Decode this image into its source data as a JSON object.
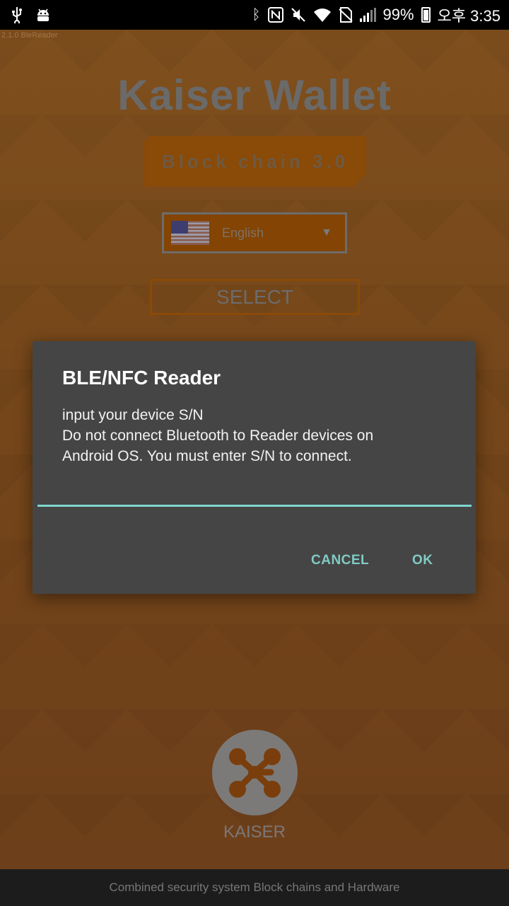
{
  "status_bar": {
    "left_icons": [
      "usb-icon",
      "android-debug-icon"
    ],
    "right_icons": [
      "bluetooth-icon",
      "nfc-icon",
      "mute-icon",
      "wifi-icon",
      "no-sim-icon",
      "signal-icon"
    ],
    "battery_percent": "99%",
    "time": "오후 3:35",
    "battery_level": 0.99
  },
  "app": {
    "version": "2.1.0 BleReader",
    "title": "Kaiser Wallet",
    "badge": "Block chain 3.0",
    "language": {
      "selected": "English",
      "flag_icon": "us-flag-icon"
    },
    "select_label": "SELECT",
    "logo_text": "KAISER",
    "footer": "Combined security system Block chains and Hardware"
  },
  "dialog": {
    "title": "BLE/NFC Reader",
    "message_lines": [
      "input your device S/N",
      "Do not connect Bluetooth to Reader devices on",
      "Android OS. You must enter S/N to connect."
    ],
    "input_value": "",
    "cancel_label": "CANCEL",
    "ok_label": "OK"
  },
  "colors": {
    "accent": "#80cbc4",
    "dialog_bg": "#454545",
    "app_bg": "#7a4a1c",
    "badge_bg": "#8a4a08"
  }
}
